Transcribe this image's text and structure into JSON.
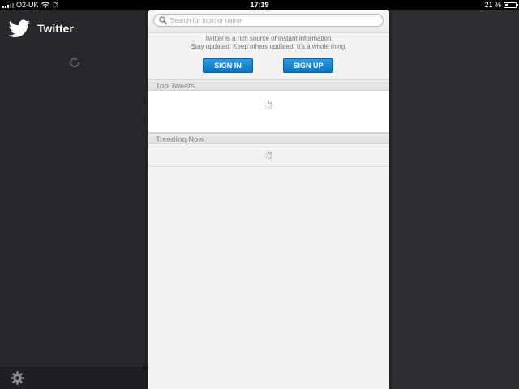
{
  "statusbar": {
    "carrier": "O2-UK",
    "time": "17:19",
    "battery_text": "21 %",
    "battery_level": 0.21
  },
  "sidebar": {
    "app_title": "Twitter",
    "icons": [
      "twitter-bird-icon",
      "refresh-icon",
      "gear-icon"
    ]
  },
  "panel": {
    "search": {
      "placeholder": "Search for topic or name",
      "value": ""
    },
    "intro_line1": "Twitter is a rich source of instant information.",
    "intro_line2": "Stay updated. Keep others updated. It's a whole thing.",
    "signin_label": "SIGN IN",
    "signup_label": "SIGN UP",
    "sections": [
      {
        "title": "Top Tweets",
        "state": "loading"
      },
      {
        "title": "Trending Now",
        "state": "loading"
      }
    ]
  },
  "colors": {
    "accent": "#1a8ad6",
    "sidebar_bg": "#26262b",
    "panel_bg": "#f2f2f2"
  }
}
